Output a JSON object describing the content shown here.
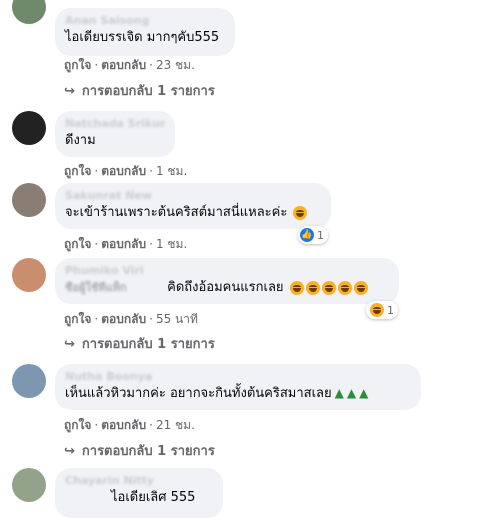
{
  "actions": {
    "like": "ถูกใจ",
    "reply": "ตอบกลับ",
    "dot": "·"
  },
  "comments": [
    {
      "name": "Anan Saisong",
      "text": "ไอเดียบรรเจิด มากๆคับ555",
      "time": "23 ชม.",
      "replies_label": "การตอบกลับ 1 รายการ"
    },
    {
      "name": "Natchada Srikum",
      "text": "ดีงาม",
      "time": "1 ชม."
    },
    {
      "name": "Sakunrat New",
      "text": "จะเข้าร้านเพราะต้นคริสต์มาสนี่แหละค่ะ",
      "time": "1 ชม.",
      "reaction_count": "1"
    },
    {
      "name": "Phumiko Viri",
      "text": "คิดถึงอ้อมคนแรกเลย",
      "time": "55 นาที",
      "reaction_count": "1",
      "replies_label": "การตอบกลับ 1 รายการ"
    },
    {
      "name": "Nutha Boonya",
      "text": "เห็นแล้วหิวมากค่ะ อยากจะกินทั้งต้นคริสมาสเลย",
      "time": "21 ชม.",
      "replies_label": "การตอบกลับ 1 รายการ"
    },
    {
      "name": "Chayarin Nitty",
      "text": "ไอเดียเลิศ 555"
    }
  ],
  "colors": {
    "bubble": "#f0f2f5",
    "meta_text": "#65676b",
    "like_blue": "#1877f2"
  }
}
